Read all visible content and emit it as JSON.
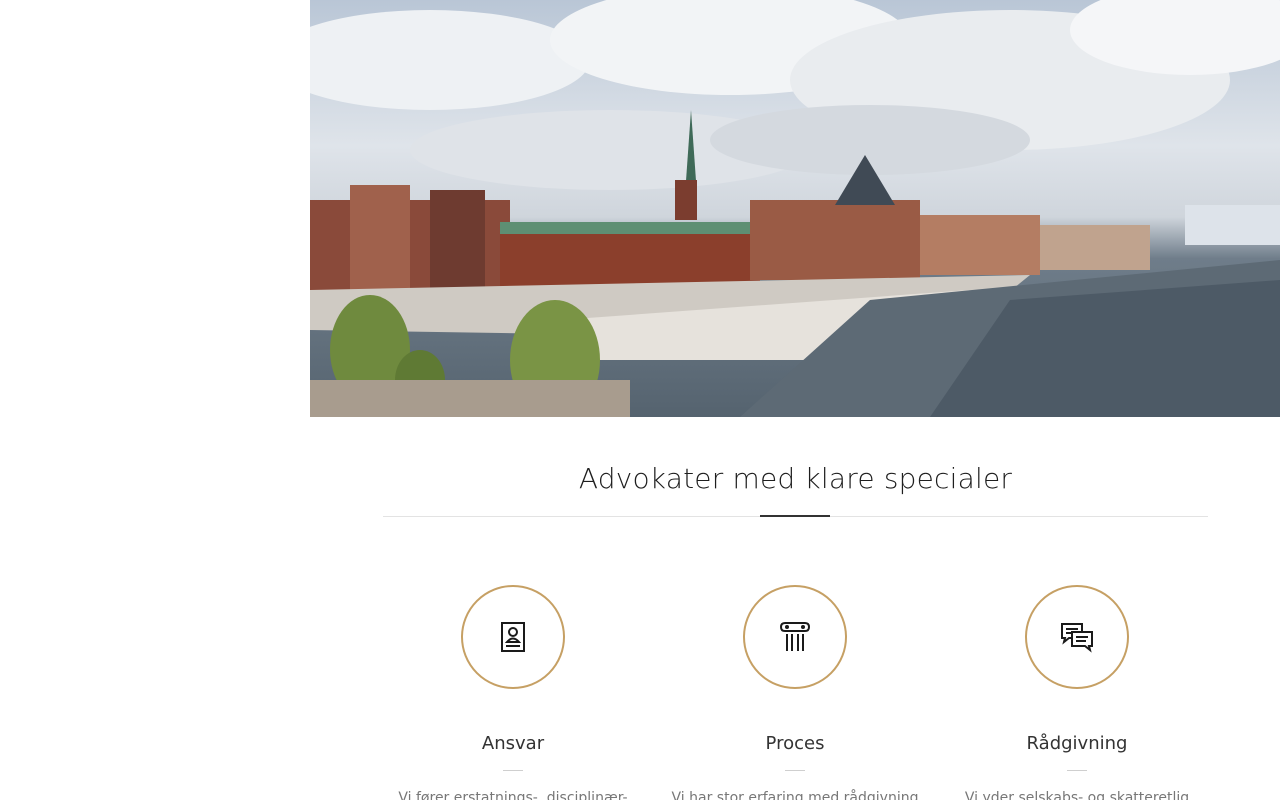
{
  "hero": {
    "image_description_icon": "harbor-city-photo"
  },
  "section": {
    "title": "Advokater med klare specialer"
  },
  "features": [
    {
      "icon": "document-person-icon",
      "title": "Ansvar",
      "desc": "Vi fører erstatnings-, disciplinær-"
    },
    {
      "icon": "column-pillar-icon",
      "title": "Proces",
      "desc": "Vi har stor erfaring med rådgivning"
    },
    {
      "icon": "speech-bubbles-icon",
      "title": "Rådgivning",
      "desc": "Vi yder selskabs- og skatteretlig"
    }
  ],
  "colors": {
    "accent": "#c6a064",
    "heading": "#1e1e1e",
    "text": "#777777"
  }
}
